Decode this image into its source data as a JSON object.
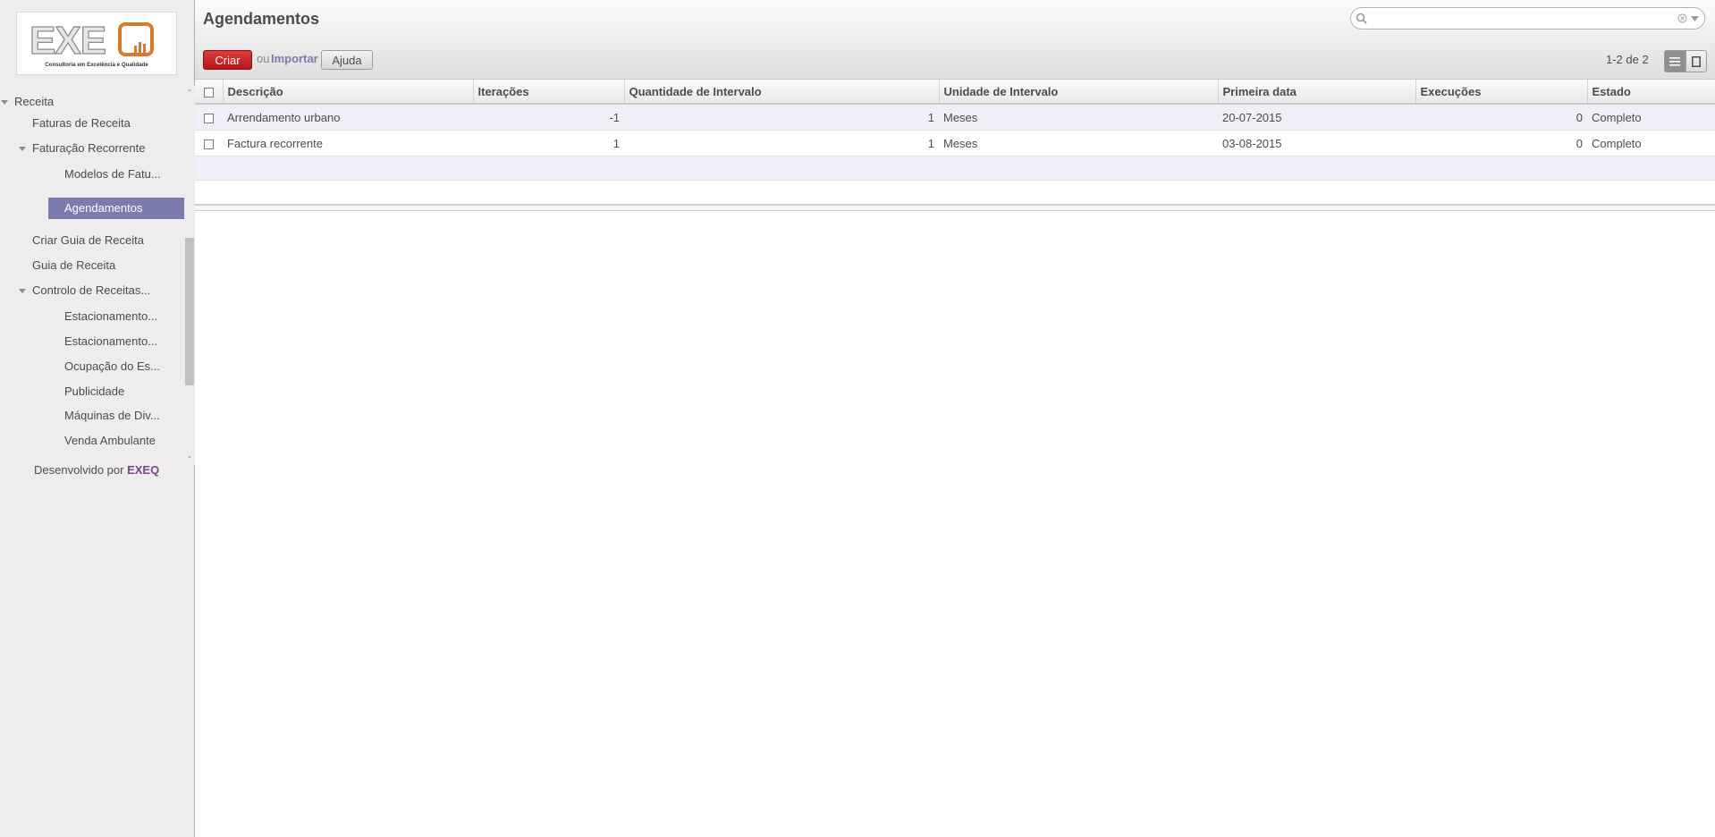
{
  "brand": {
    "logo_text": "EXEQ",
    "logo_tagline": "Consultoria em Excelência e Qualidade",
    "accent": "#7c7bad",
    "primary_button": "#c02020"
  },
  "sidebar": {
    "items": [
      {
        "label": "Receita",
        "level": 0,
        "expanded": true
      },
      {
        "label": "Faturas de Receita",
        "level": 1
      },
      {
        "label": "Faturação Recorrente",
        "level": 1,
        "expanded": true
      },
      {
        "label": "Modelos de Fatu...",
        "level": 2
      },
      {
        "label": "Agendamentos",
        "level": 2,
        "active": true
      },
      {
        "label": "Criar Guia de Receita",
        "level": 1
      },
      {
        "label": "Guia de Receita",
        "level": 1
      },
      {
        "label": "Controlo de Receitas...",
        "level": 1,
        "expanded": true
      },
      {
        "label": "Estacionamento...",
        "level": 2
      },
      {
        "label": "Estacionamento...",
        "level": 2
      },
      {
        "label": "Ocupação do Es...",
        "level": 2
      },
      {
        "label": "Publicidade",
        "level": 2
      },
      {
        "label": "Máquinas de Div...",
        "level": 2
      },
      {
        "label": "Venda Ambulante",
        "level": 2
      }
    ],
    "footer_prefix": "Desenvolvido por",
    "footer_brand": "EXEQ"
  },
  "header": {
    "title": "Agendamentos",
    "search_placeholder": "",
    "create_label": "Criar",
    "or_label": "ou",
    "import_label": "Importar",
    "help_label": "Ajuda",
    "pager": "1-2 de 2"
  },
  "table": {
    "columns": [
      "Descrição",
      "Iterações",
      "Quantidade de Intervalo",
      "Unidade de Intervalo",
      "Primeira data",
      "Execuções",
      "Estado"
    ],
    "rows": [
      {
        "descricao": "Arrendamento urbano",
        "iteracoes": "-1",
        "quantidade": "1",
        "unidade": "Meses",
        "primeira_data": "20-07-2015",
        "execucoes": "0",
        "estado": "Completo"
      },
      {
        "descricao": "Factura recorrente",
        "iteracoes": "1",
        "quantidade": "1",
        "unidade": "Meses",
        "primeira_data": "03-08-2015",
        "execucoes": "0",
        "estado": "Completo"
      }
    ]
  }
}
